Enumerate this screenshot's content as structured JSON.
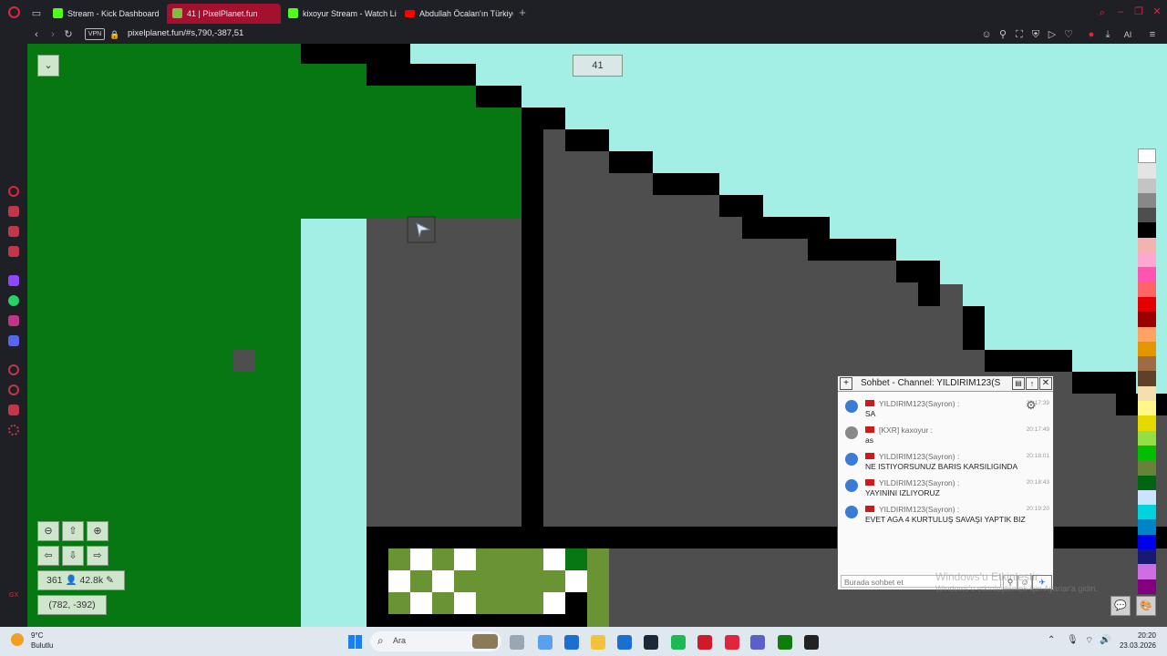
{
  "browser": {
    "tabs": [
      {
        "label": "Stream - Kick Dashboard",
        "color": "#53fc18"
      },
      {
        "label": "41 | PixelPlanet.fun",
        "color": "#7fbf3f"
      },
      {
        "label": "kixoyur Stream - Watch Li",
        "color": "#53fc18"
      },
      {
        "label": "Abdullah Öcalan'ın Türkiye",
        "color": "#ff0000"
      }
    ],
    "new_tab_icon": "plus-icon",
    "vpn_label": "VPN",
    "url": "pixelplanet.fun/#s,790,-387,51",
    "toolbar_ai_label": "AI"
  },
  "canvas": {
    "online_count_label": "41",
    "users_online": "361",
    "pixel_count": "42.8k",
    "coordinates": "(782, -392)",
    "colors": {
      "sky": "#a3eee5",
      "green": "#067711",
      "gray": "#4e4e4e",
      "black": "#000000",
      "olive": "#6a9433"
    }
  },
  "palette": [
    "#ffffff",
    "#e4e4e4",
    "#c4c4c4",
    "#888888",
    "#4e4e4e",
    "#000000",
    "#f4b3ae",
    "#ffa7d1",
    "#ff54b2",
    "#ff6565",
    "#e50000",
    "#9a0000",
    "#fea460",
    "#e59500",
    "#a06a42",
    "#604028",
    "#f5dfb0",
    "#fff889",
    "#e5d900",
    "#94e044",
    "#02be01",
    "#688338",
    "#006513",
    "#cae3ff",
    "#00d3dd",
    "#0083c7",
    "#0000ea",
    "#191973",
    "#cf6ee4",
    "#820080"
  ],
  "chat": {
    "title": "Sohbet - Channel: YILDIRIM123(S",
    "messages": [
      {
        "user": "YILDIRIM123(Sayron) :",
        "time": "20:17:39",
        "text": "SA"
      },
      {
        "user": "[KXR] kaxoyur :",
        "time": "20:17:49",
        "text": "as"
      },
      {
        "user": "YILDIRIM123(Sayron) :",
        "time": "20:18:01",
        "text": "NE ISTIYORSUNUZ BARIS KARSILIGINDA"
      },
      {
        "user": "YILDIRIM123(Sayron) :",
        "time": "20:18:43",
        "text": "YAYININI IZLIYORUZ"
      },
      {
        "user": "YILDIRIM123(Sayron) :",
        "time": "20:19:20",
        "text": "EVET AGA 4 KURTULUŞ SAVAŞI YAPTIK BIZ"
      }
    ],
    "input_placeholder": "Burada sohbet et"
  },
  "watermark": {
    "line1": "Windows'u Etkinleştir",
    "line2": "Windows'u etkinleştirmek için Ayarlar'a gidin."
  },
  "taskbar": {
    "weather_temp": "9°C",
    "weather_desc": "Bulutlu",
    "search_label": "Ara",
    "time": "20:20",
    "date": "23.03.2026"
  }
}
